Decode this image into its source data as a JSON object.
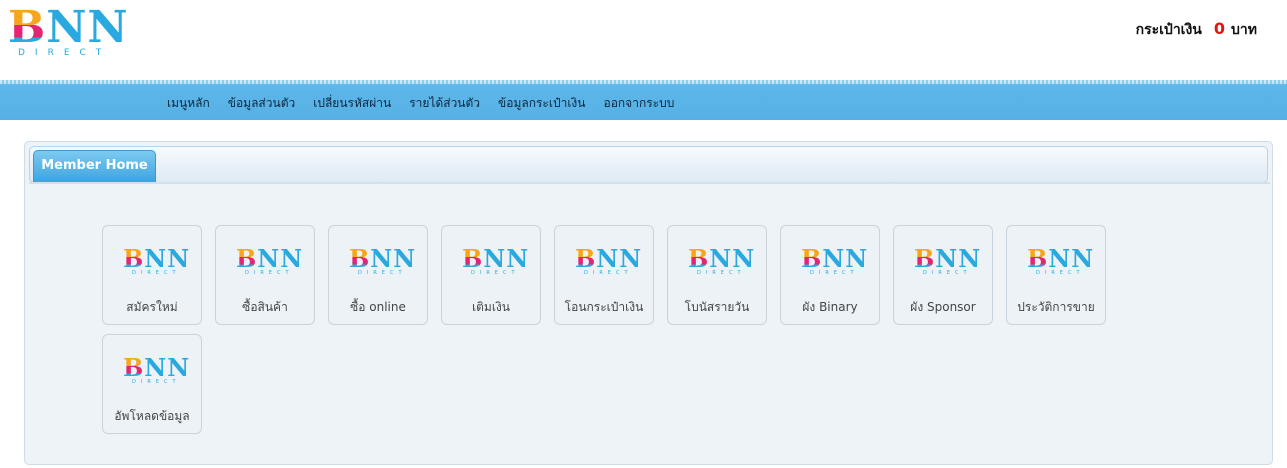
{
  "brand": {
    "letters": [
      "B",
      "N",
      "N"
    ],
    "subtitle": "DIRECT",
    "colors": {
      "b_top": "#f6a51c",
      "b_mid": "#e6256f",
      "blue": "#29a9e0"
    }
  },
  "wallet": {
    "label": "กระเป๋าเงิน",
    "amount": "0",
    "unit": "บาท",
    "amount_color": "#e3150f"
  },
  "nav": {
    "items": [
      {
        "label": "เมนูหลัก"
      },
      {
        "label": "ข้อมูลส่วนตัว"
      },
      {
        "label": "เปลี่ยนรหัสผ่าน"
      },
      {
        "label": "รายได้ส่วนตัว"
      },
      {
        "label": "ข้อมูลกระเป๋าเงิน"
      },
      {
        "label": "ออกจากระบบ"
      }
    ]
  },
  "panel": {
    "tab_label": "Member Home",
    "tiles": [
      {
        "label": "สมัครใหม่",
        "icon": "bnn-logo-icon"
      },
      {
        "label": "ซื้อสินค้า",
        "icon": "bnn-logo-icon"
      },
      {
        "label": "ซื้อ online",
        "icon": "bnn-logo-icon"
      },
      {
        "label": "เติมเงิน",
        "icon": "bnn-logo-icon"
      },
      {
        "label": "โอนกระเป๋าเงิน",
        "icon": "bnn-logo-icon"
      },
      {
        "label": "โบนัสรายวัน",
        "icon": "bnn-logo-icon"
      },
      {
        "label": "ผัง Binary",
        "icon": "bnn-logo-icon"
      },
      {
        "label": "ผัง Sponsor",
        "icon": "bnn-logo-icon"
      },
      {
        "label": "ประวัติการขาย",
        "icon": "bnn-logo-icon"
      },
      {
        "label": "อัพโหลดข้อมูล",
        "icon": "bnn-logo-icon"
      }
    ]
  }
}
